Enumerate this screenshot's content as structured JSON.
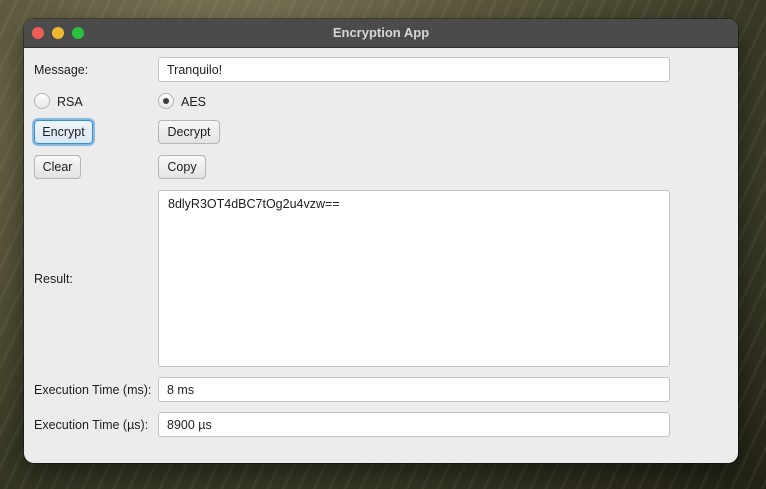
{
  "window": {
    "title": "Encryption App"
  },
  "form": {
    "message_label": "Message:",
    "message_value": "Tranquilo!",
    "algorithms": [
      {
        "label": "RSA",
        "selected": false
      },
      {
        "label": "AES",
        "selected": true
      }
    ],
    "buttons": {
      "encrypt": "Encrypt",
      "decrypt": "Decrypt",
      "clear": "Clear",
      "copy": "Copy"
    },
    "result_label": "Result:",
    "result_value": "8dlyR3OT4dBC7tOg2u4vzw==",
    "exec_ms_label": "Execution Time (ms):",
    "exec_ms_value": "8 ms",
    "exec_us_label": "Execution Time (µs):",
    "exec_us_value": "8900 µs"
  }
}
